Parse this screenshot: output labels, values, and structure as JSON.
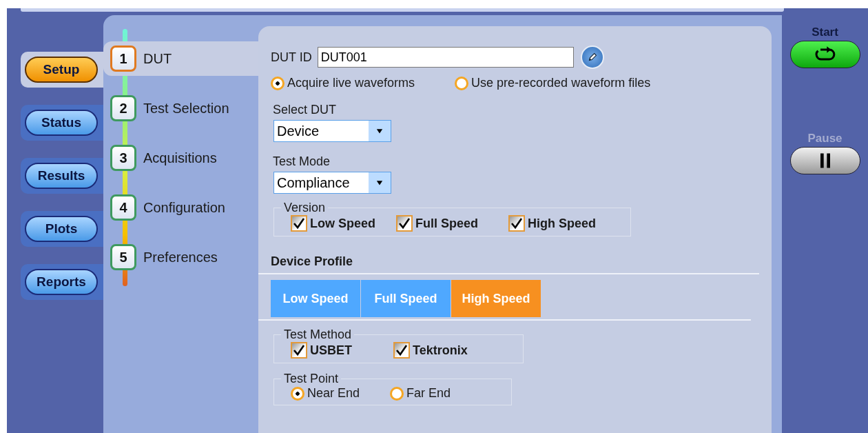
{
  "nav": [
    {
      "label": "Setup",
      "selected": true
    },
    {
      "label": "Status",
      "selected": false
    },
    {
      "label": "Results",
      "selected": false
    },
    {
      "label": "Plots",
      "selected": false
    },
    {
      "label": "Reports",
      "selected": false
    }
  ],
  "steps": [
    {
      "number": "1",
      "label": "DUT",
      "selected": true
    },
    {
      "number": "2",
      "label": "Test Selection",
      "selected": false
    },
    {
      "number": "3",
      "label": "Acquisitions",
      "selected": false
    },
    {
      "number": "4",
      "label": "Configuration",
      "selected": false
    },
    {
      "number": "5",
      "label": "Preferences",
      "selected": false
    }
  ],
  "dut_id": {
    "label": "DUT ID",
    "value": "DUT001"
  },
  "source": [
    {
      "label": "Acquire live waveforms",
      "selected": true
    },
    {
      "label": "Use pre-recorded waveform files",
      "selected": false
    }
  ],
  "select_dut": {
    "label": "Select DUT",
    "value": "Device"
  },
  "test_mode": {
    "label": "Test Mode",
    "value": "Compliance"
  },
  "version": {
    "title": "Version",
    "options": [
      {
        "label": "Low Speed",
        "checked": true
      },
      {
        "label": "Full Speed",
        "checked": true
      },
      {
        "label": "High Speed",
        "checked": true
      }
    ]
  },
  "device_profile": {
    "title": "Device Profile",
    "tabs": [
      {
        "label": "Low Speed",
        "selected": false
      },
      {
        "label": "Full Speed",
        "selected": false
      },
      {
        "label": "High Speed",
        "selected": true
      }
    ]
  },
  "test_method": {
    "title": "Test Method",
    "options": [
      {
        "label": "USBET",
        "checked": true
      },
      {
        "label": "Tektronix",
        "checked": true
      }
    ]
  },
  "test_point": {
    "title": "Test Point",
    "options": [
      {
        "label": "Near End",
        "selected": true
      },
      {
        "label": "Far End",
        "selected": false
      }
    ]
  },
  "run": [
    {
      "kind": "start",
      "label": "Start",
      "disabled": false
    },
    {
      "kind": "pause",
      "label": "Pause",
      "disabled": true
    }
  ]
}
